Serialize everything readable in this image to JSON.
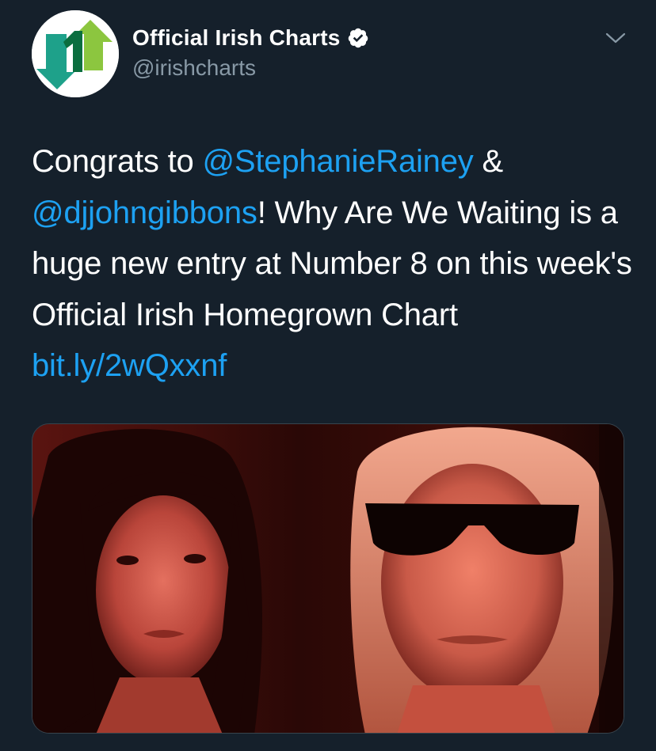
{
  "account": {
    "display_name": "Official Irish Charts",
    "handle": "@irishcharts",
    "verified": true,
    "avatar_icon": "irish-charts-logo-icon",
    "verified_icon": "verified-badge-icon"
  },
  "menu": {
    "icon": "chevron-down-icon"
  },
  "tweet": {
    "t1": "Congrats to ",
    "mention1": "@StephanieRainey",
    "t2": " & ",
    "mention2": "@djjohngibbons",
    "t3": "! Why Are We Waiting is a huge new entry at Number 8 on this week's Official Irish Homegrown Chart ",
    "link": "bit.ly/2wQxxnf"
  },
  "media": {
    "type": "photo"
  },
  "colors": {
    "background": "#15202b",
    "accent": "#1da1f2",
    "secondary_text": "#8899a6",
    "verified_badge": "#ffffff"
  }
}
